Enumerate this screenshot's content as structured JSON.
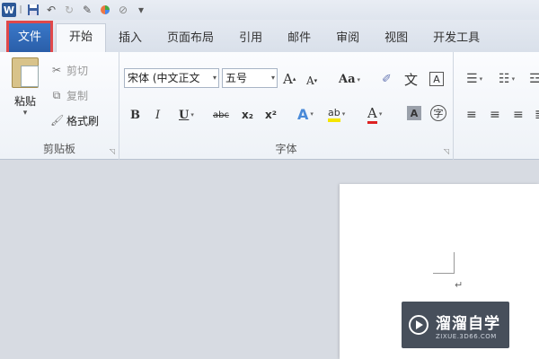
{
  "quick_access": {
    "app_icon_letter": "W",
    "separator": "|",
    "customize": "▾"
  },
  "tabs": [
    {
      "label": "文件"
    },
    {
      "label": "开始"
    },
    {
      "label": "插入"
    },
    {
      "label": "页面布局"
    },
    {
      "label": "引用"
    },
    {
      "label": "邮件"
    },
    {
      "label": "审阅"
    },
    {
      "label": "视图"
    },
    {
      "label": "开发工具"
    }
  ],
  "clipboard": {
    "paste": "粘贴",
    "cut": "剪切",
    "copy": "复制",
    "format_painter": "格式刷",
    "group_label": "剪贴板"
  },
  "font": {
    "font_name": "宋体 (中文正文",
    "font_size": "五号",
    "grow": "A",
    "shrink": "A",
    "change_case": "Aa",
    "phonetic": "文",
    "char_border": "A",
    "bold": "B",
    "italic": "I",
    "underline": "U",
    "strikethrough": "abc",
    "subscript": "x₂",
    "superscript": "x²",
    "text_effects": "A",
    "highlight": "ab",
    "font_color": "A",
    "char_shading": "A",
    "enclose": "字",
    "group_label": "字体"
  },
  "watermark": {
    "title": "溜溜自学",
    "url": "ZIXUE.3D66.COM"
  },
  "colors": {
    "file_tab": "#2a5ea9",
    "highlight_outline": "#e0484a"
  }
}
